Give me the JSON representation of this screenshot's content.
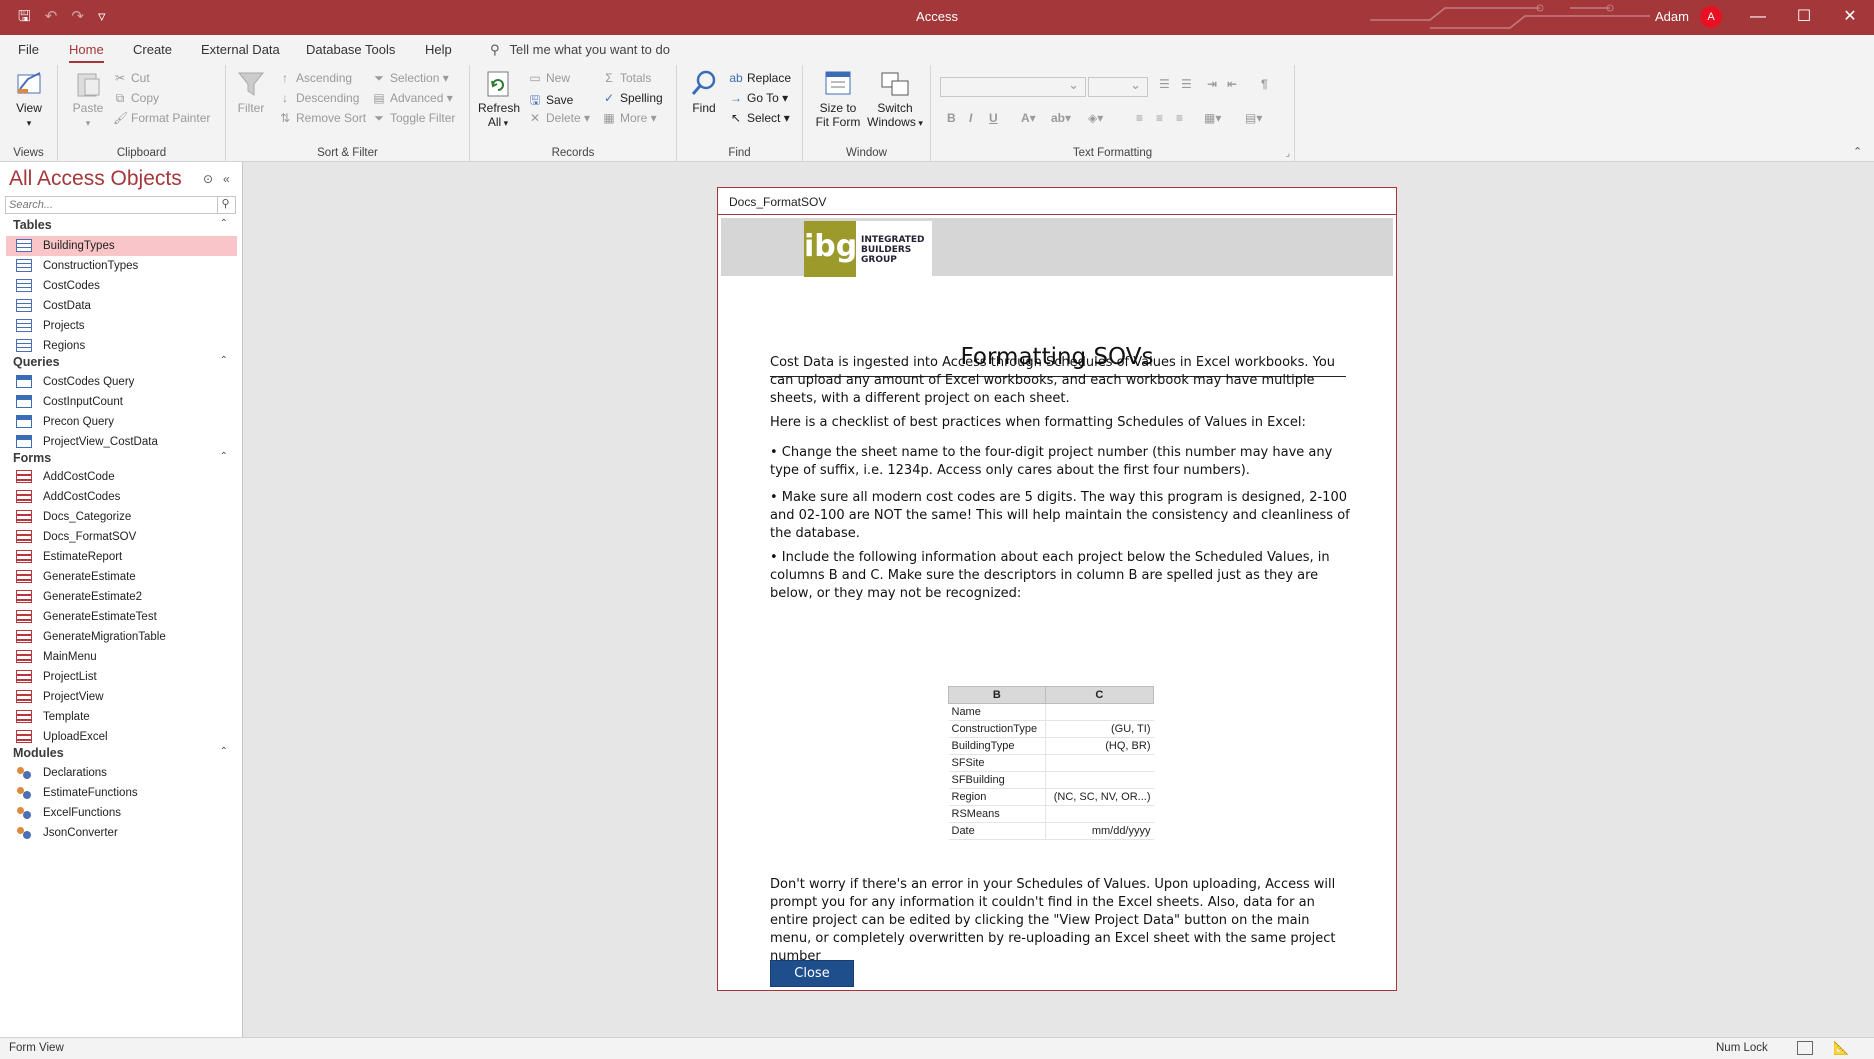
{
  "app": {
    "title": "Access",
    "user_name": "Adam",
    "user_initial": "A"
  },
  "ribbon_tabs": [
    "File",
    "Home",
    "Create",
    "External Data",
    "Database Tools",
    "Help"
  ],
  "tell_me": "Tell me what you want to do",
  "ribbon": {
    "views": {
      "view": "View",
      "group": "Views"
    },
    "clipboard": {
      "paste": "Paste",
      "cut": "Cut",
      "copy": "Copy",
      "format_painter": "Format Painter",
      "group": "Clipboard"
    },
    "sort_filter": {
      "filter": "Filter",
      "ascending": "Ascending",
      "descending": "Descending",
      "remove_sort": "Remove Sort",
      "selection": "Selection",
      "advanced": "Advanced",
      "toggle_filter": "Toggle Filter",
      "group": "Sort & Filter"
    },
    "records": {
      "refresh": "Refresh",
      "refresh2": "All",
      "new": "New",
      "save": "Save",
      "delete": "Delete",
      "totals": "Totals",
      "spelling": "Spelling",
      "more": "More",
      "group": "Records"
    },
    "find": {
      "find": "Find",
      "replace": "Replace",
      "goto": "Go To",
      "select": "Select",
      "group": "Find"
    },
    "window": {
      "size1": "Size to",
      "size2": "Fit Form",
      "switch1": "Switch",
      "switch2": "Windows",
      "group": "Window"
    },
    "text_formatting": {
      "group": "Text Formatting"
    }
  },
  "nav": {
    "title": "All Access Objects",
    "search_placeholder": "Search...",
    "sections": {
      "tables": {
        "label": "Tables",
        "items": [
          "BuildingTypes",
          "ConstructionTypes",
          "CostCodes",
          "CostData",
          "Projects",
          "Regions"
        ]
      },
      "queries": {
        "label": "Queries",
        "items": [
          "CostCodes Query",
          "CostInputCount",
          "Precon Query",
          "ProjectView_CostData"
        ]
      },
      "forms": {
        "label": "Forms",
        "items": [
          "AddCostCode",
          "AddCostCodes",
          "Docs_Categorize",
          "Docs_FormatSOV",
          "EstimateReport",
          "GenerateEstimate",
          "GenerateEstimate2",
          "GenerateEstimateTest",
          "GenerateMigrationTable",
          "MainMenu",
          "ProjectList",
          "ProjectView",
          "Template",
          "UploadExcel"
        ]
      },
      "modules": {
        "label": "Modules",
        "items": [
          "Declarations",
          "EstimateFunctions",
          "ExcelFunctions",
          "JsonConverter"
        ]
      }
    }
  },
  "form": {
    "window_title": "Docs_FormatSOV",
    "logo": {
      "mark": "ibg",
      "line1": "INTEGRATED",
      "line2": "BUILDERS",
      "line3": "GROUP"
    },
    "title": "Formatting SOVs",
    "paragraphs": [
      "Cost Data is ingested into Access through Schedules of Values in Excel workbooks. You can upload any amount of Excel workbooks, and each workbook may have multiple sheets, with a different project on each sheet.",
      "Here is a checklist of best practices when formatting Schedules of Values in Excel:",
      "• Change the sheet name to the four-digit project number (this number may have any type of suffix, i.e. 1234p. Access only cares about the first four numbers).",
      "• Make sure all modern cost codes are 5 digits. The way this program is designed, 2-100 and 02-100 are NOT the same! This will help maintain the consistency and cleanliness of the database.",
      "• Include the following information about each project below the Scheduled Values, in columns B and C. Make sure the descriptors in column B are spelled just as they are below, or they may not be recognized:",
      "Don't worry if there's an error in your Schedules of Values. Upon uploading, Access will prompt you for any information it couldn't find in the Excel sheets. Also, data for an entire project can be edited by clicking the \"View Project Data\" button on the main menu, or completely overwritten by re-uploading an Excel sheet with the same project number"
    ],
    "excel_table": {
      "headers": [
        "B",
        "C"
      ],
      "rows": [
        [
          "Name",
          ""
        ],
        [
          "ConstructionType",
          "(GU, TI)"
        ],
        [
          "BuildingType",
          "(HQ, BR)"
        ],
        [
          "SFSite",
          ""
        ],
        [
          "SFBuilding",
          ""
        ],
        [
          "Region",
          "(NC, SC, NV, OR...)"
        ],
        [
          "RSMeans",
          ""
        ],
        [
          "Date",
          "mm/dd/yyyy"
        ]
      ]
    },
    "close_label": "Close"
  },
  "status": {
    "left": "Form View",
    "num_lock": "Num Lock"
  },
  "colors": {
    "accent": "#a4373a",
    "button": "#1f4e8c",
    "selected_nav": "#f9c5c8"
  }
}
